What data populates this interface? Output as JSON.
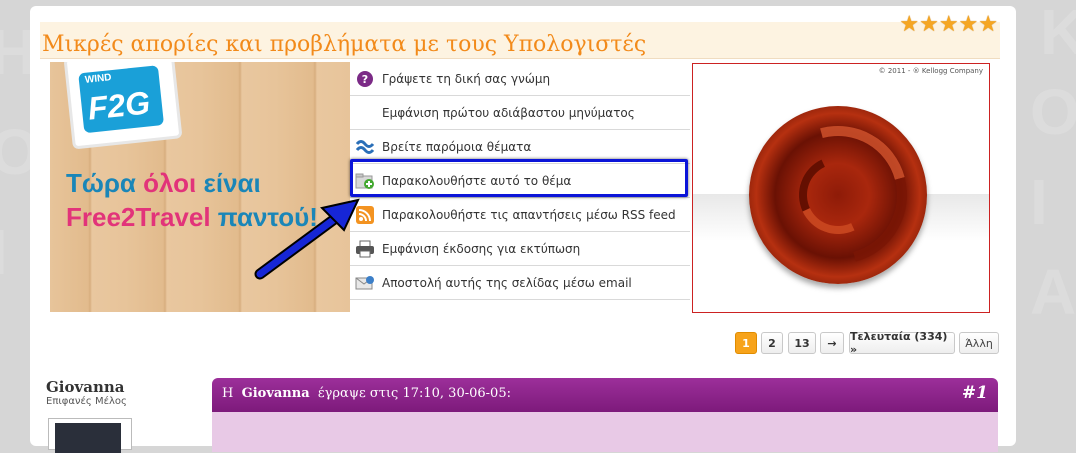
{
  "thread": {
    "title": "Μικρές απορίες και προβλήματα με τους Υπολογιστές",
    "stars": "★★★★★"
  },
  "left_ad": {
    "brand": "WIND",
    "logo": "F2G",
    "line1_a": "Τώρα ",
    "line1_b": "όλοι",
    "line1_c": " είναι",
    "line2_a": "Free2Travel ",
    "line2_b": "παντού!"
  },
  "menu": {
    "items": [
      {
        "label": "Γράψετε τη δική σας γνώμη",
        "icon": "reply-icon"
      },
      {
        "label": "Εμφάνιση πρώτου αδιάβαστου μηνύματος",
        "icon": "none"
      },
      {
        "label": "Βρείτε παρόμοια θέματα",
        "icon": "similar-threads-icon"
      },
      {
        "label": "Παρακολουθήστε αυτό το θέμα",
        "icon": "subscribe-folder-icon"
      },
      {
        "label": "Παρακολουθήστε τις απαντήσεις μέσω RSS feed",
        "icon": "rss-icon"
      },
      {
        "label": "Εμφάνιση έκδοσης για εκτύπωση",
        "icon": "printer-icon"
      },
      {
        "label": "Αποστολή αυτής της σελίδας μέσω email",
        "icon": "email-icon"
      }
    ]
  },
  "right_ad": {
    "copyright": "© 2011 - ® Kellogg Company"
  },
  "pagination": {
    "current": "1",
    "page2": "2",
    "page13": "13",
    "next": "→",
    "last": "Τελευταία (334) »",
    "other": "Άλλη"
  },
  "post": {
    "author": "Giovanna",
    "role": "Επιφανές Μέλος",
    "header_prefix": "Η",
    "header_author": "Giovanna",
    "header_suffix": "έγραψε στις 17:10, 30-06-05:",
    "number": "#1"
  },
  "colors": {
    "accent_orange": "#f28a1a",
    "post_header": "#8c248a",
    "highlight_box": "#0b14d8",
    "arrow": "#1626d6"
  }
}
